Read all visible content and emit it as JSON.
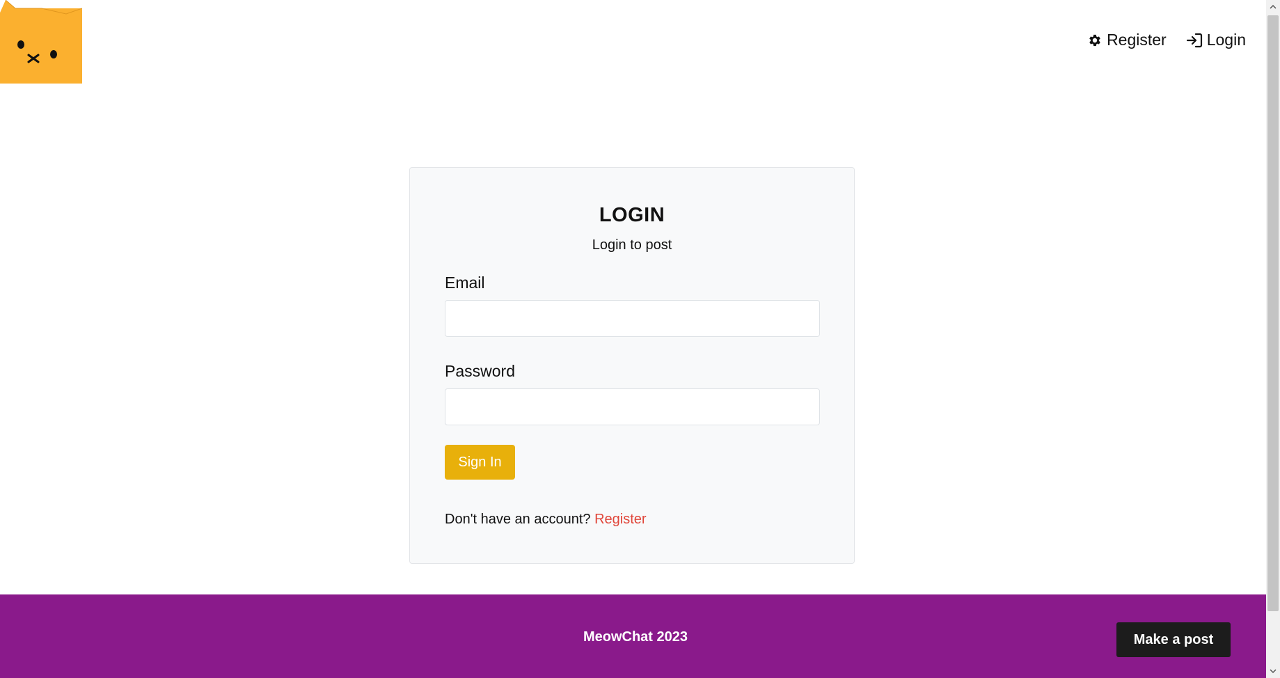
{
  "header": {
    "logo_icon": "cat-face-icon",
    "nav": [
      {
        "label": "Register",
        "icon": "gear-icon"
      },
      {
        "label": "Login",
        "icon": "login-arrow-icon"
      }
    ]
  },
  "login": {
    "title": "LOGIN",
    "subtitle": "Login to post",
    "email_label": "Email",
    "email_value": "",
    "password_label": "Password",
    "password_value": "",
    "submit_label": "Sign In",
    "account_prompt": "Don't have an account?",
    "register_link": "Register"
  },
  "footer": {
    "text": "MeowChat 2023",
    "post_button": "Make a post"
  },
  "colors": {
    "accent_yellow": "#e8b00b",
    "footer_purple": "#8a1a8b",
    "link_red": "#e0463a",
    "logo_orange": "#fbb02f",
    "card_bg": "#f8f9fa"
  }
}
